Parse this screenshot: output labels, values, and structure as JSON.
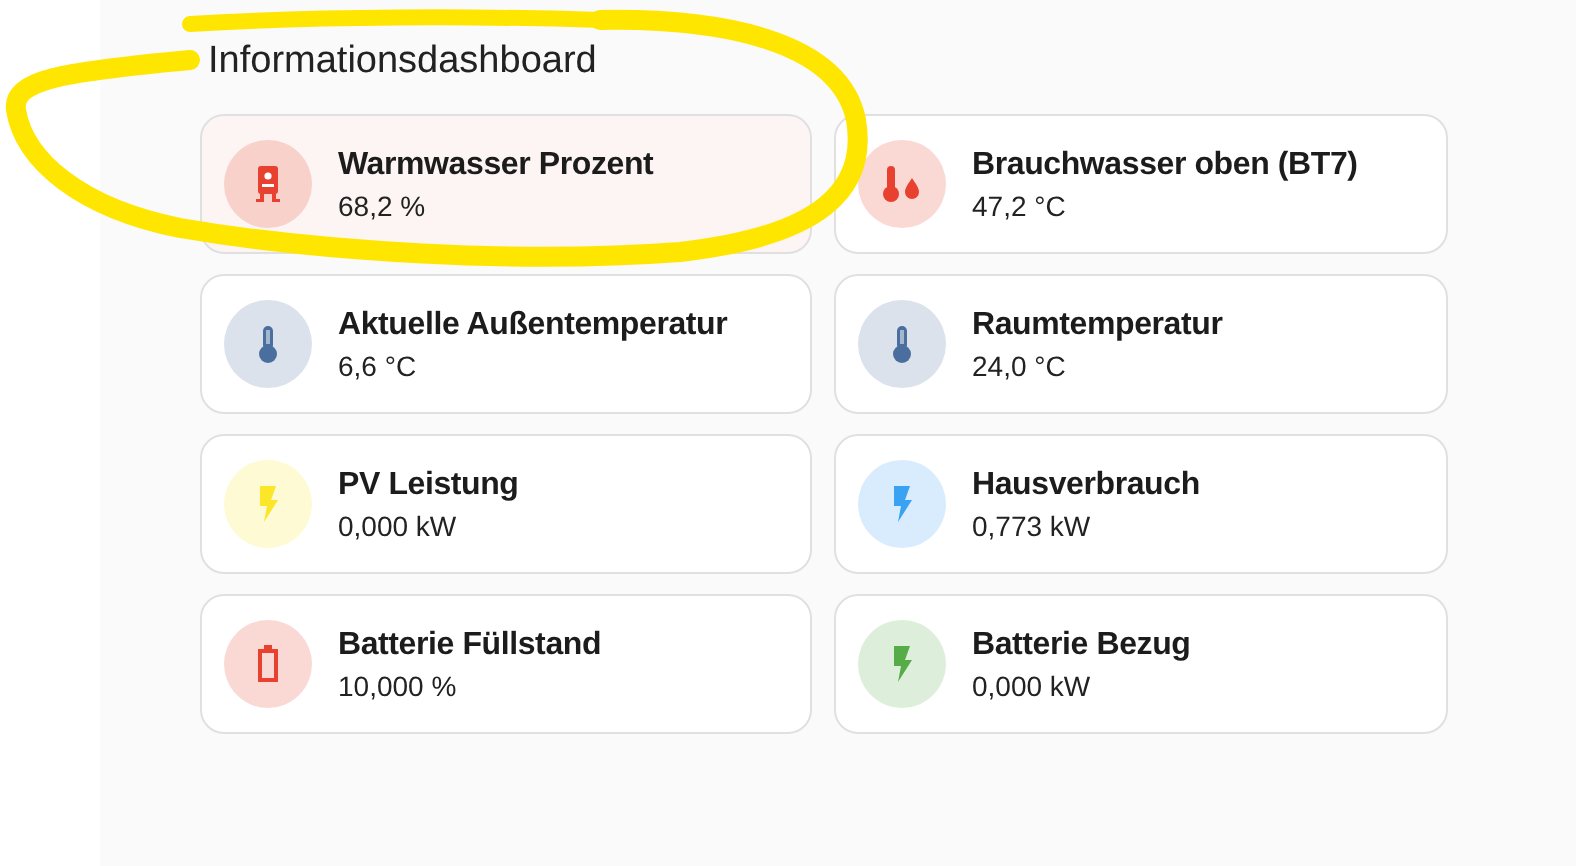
{
  "title": "Informationsdashboard",
  "tiles": [
    {
      "name": "Warmwasser Prozent",
      "state": "68,2 %",
      "kind": "boiler",
      "color": "#e8412f",
      "active": true
    },
    {
      "name": "Brauchwasser oben (BT7)",
      "state": "47,2 °C",
      "kind": "thermometer-drop",
      "color": "#e8412f",
      "active": false
    },
    {
      "name": "Aktuelle Außentemperatur",
      "state": "6,6 °C",
      "kind": "thermometer",
      "color": "#4a6f9e",
      "active": false
    },
    {
      "name": "Raumtemperatur",
      "state": "24,0 °C",
      "kind": "thermometer",
      "color": "#4a6f9e",
      "active": false
    },
    {
      "name": "PV Leistung",
      "state": "0,000 kW",
      "kind": "bolt",
      "color": "#fbe62a",
      "active": false
    },
    {
      "name": "Hausverbrauch",
      "state": "0,773 kW",
      "kind": "bolt",
      "color": "#3aa2f3",
      "active": false
    },
    {
      "name": "Batterie Füllstand",
      "state": "10,000 %",
      "kind": "battery",
      "color": "#e8412f",
      "active": false
    },
    {
      "name": "Batterie Bezug",
      "state": "0,000 kW",
      "kind": "bolt",
      "color": "#56ad47",
      "active": false
    }
  ]
}
